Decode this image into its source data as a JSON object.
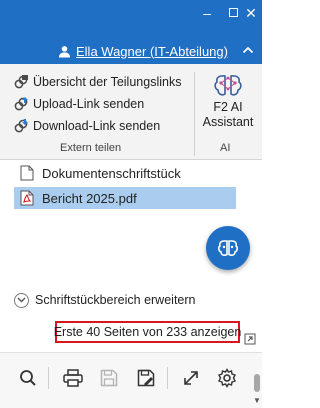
{
  "window": {
    "minimize_glyph": "–",
    "close_glyph": "✕"
  },
  "header": {
    "user_name": "Ella Wagner (IT-Abteilung)",
    "accent_color": "#1f6fc5"
  },
  "ribbon": {
    "extern_teilen": {
      "items": [
        {
          "label": "Übersicht der Teilungslinks",
          "icon": "link-overview-icon"
        },
        {
          "label": "Upload-Link senden",
          "icon": "upload-link-icon"
        },
        {
          "label": "Download-Link senden",
          "icon": "download-link-icon"
        }
      ],
      "group_label": "Extern teilen"
    },
    "ai": {
      "button_line1": "F2 AI",
      "button_line2": "Assistant",
      "group_label": "AI"
    }
  },
  "documents": [
    {
      "name": "Dokumentenschriftstück",
      "icon": "document-icon",
      "selected": false
    },
    {
      "name": "Bericht 2025.pdf",
      "icon": "pdf-icon",
      "selected": true
    }
  ],
  "expand": {
    "label": "Schriftstückbereich erweitern"
  },
  "pages_info": {
    "label": "Erste 40 Seiten von 233 anzeigen",
    "highlight_color": "#d9161e"
  },
  "toolbar": {
    "buttons": [
      "search-icon",
      "print-icon",
      "save-icon",
      "save-as-icon",
      "expand-icon",
      "settings-icon"
    ]
  }
}
